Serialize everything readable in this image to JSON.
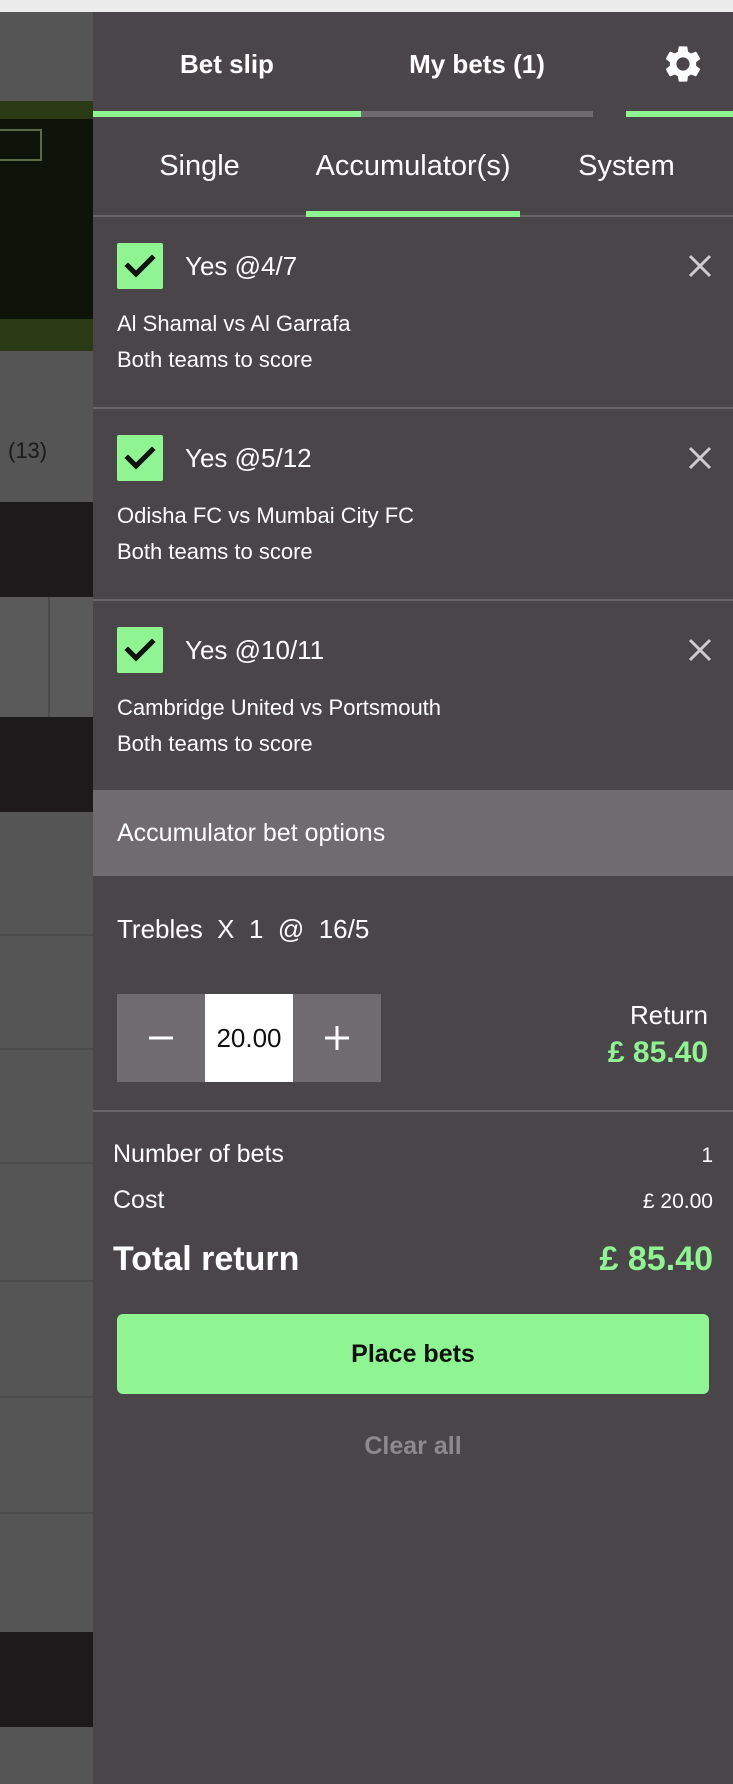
{
  "background": {
    "count_label": "(13)"
  },
  "header": {
    "tabs": [
      {
        "label": "Bet slip",
        "active": true
      },
      {
        "label": "My bets (1)",
        "active": false
      }
    ],
    "settings_icon": "gear-icon"
  },
  "subtabs": [
    {
      "label": "Single",
      "active": false
    },
    {
      "label": "Accumulator(s)",
      "active": true
    },
    {
      "label": "System",
      "active": false
    }
  ],
  "selections": [
    {
      "odds_label": "Yes @4/7",
      "match": "Al Shamal vs Al Garrafa",
      "market": "Both teams to score",
      "checked": true
    },
    {
      "odds_label": "Yes @5/12",
      "match": "Odisha FC vs Mumbai City FC",
      "market": "Both teams to score",
      "checked": true
    },
    {
      "odds_label": "Yes @10/11",
      "match": "Cambridge United vs Portsmouth",
      "market": "Both teams to score",
      "checked": true
    }
  ],
  "accumulator": {
    "options_title": "Accumulator bet options",
    "bet_label": "Trebles  X  1  @  16/5",
    "stake": "20.00",
    "return_label": "Return",
    "return_value": "£ 85.40"
  },
  "summary": {
    "number_of_bets_label": "Number of bets",
    "number_of_bets_value": "1",
    "cost_label": "Cost",
    "cost_value": "£ 20.00",
    "total_return_label": "Total return",
    "total_return_value": "£ 85.40"
  },
  "actions": {
    "place_bets": "Place bets",
    "clear_all": "Clear all"
  },
  "colors": {
    "accent": "#8ef592",
    "panel": "#4a4549",
    "options_bar": "#706b6f"
  }
}
